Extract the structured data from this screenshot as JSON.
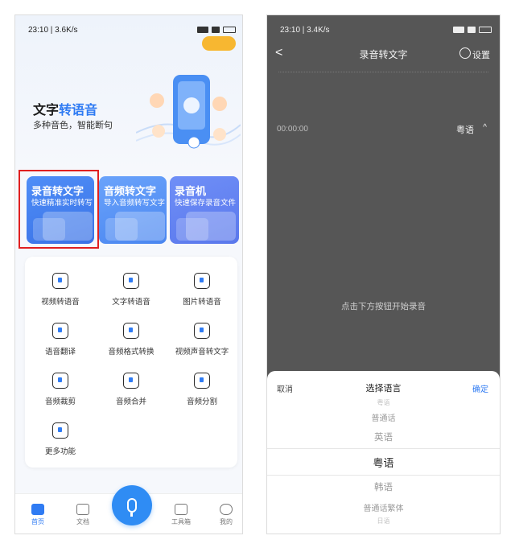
{
  "left": {
    "status": {
      "time": "23:10 | 3.6K/s"
    },
    "hero": {
      "title_prefix": "文字",
      "title_highlight": "转语音",
      "subtitle": "多种音色，智能断句"
    },
    "cards": [
      {
        "title": "录音转文字",
        "subtitle": "快速精准实时转写"
      },
      {
        "title": "音频转文字",
        "subtitle": "导入音频转写文字"
      },
      {
        "title": "录音机",
        "subtitle": "快速保存录音文件"
      }
    ],
    "grid": [
      {
        "label": "视频转语音",
        "icon": "video-play-icon"
      },
      {
        "label": "文字转语音",
        "icon": "text-t-icon"
      },
      {
        "label": "图片转语音",
        "icon": "image-icon"
      },
      {
        "label": "语音翻译",
        "icon": "translate-icon"
      },
      {
        "label": "音频格式转换",
        "icon": "convert-icon"
      },
      {
        "label": "视频声音转文字",
        "icon": "video-text-icon"
      },
      {
        "label": "音频裁剪",
        "icon": "crop-icon"
      },
      {
        "label": "音频合并",
        "icon": "merge-icon"
      },
      {
        "label": "音频分割",
        "icon": "split-icon"
      },
      {
        "label": "更多功能",
        "icon": "more-grid-icon"
      }
    ],
    "nav": [
      {
        "label": "首页",
        "icon": "home-icon",
        "active": true
      },
      {
        "label": "文档",
        "icon": "folder-icon",
        "active": false
      },
      {
        "label": "工具箱",
        "icon": "toolbox-icon",
        "active": false
      },
      {
        "label": "我的",
        "icon": "profile-icon",
        "active": false
      }
    ],
    "accent": "#2f7bf3"
  },
  "right": {
    "status": {
      "time": "23:10 | 3.4K/s"
    },
    "header": {
      "back": "<",
      "title": "录音转文字",
      "settings": "设置"
    },
    "timer": "00:00:00",
    "current_language": "粤语",
    "hint": "点击下方按钮开始录音",
    "sheet": {
      "cancel": "取消",
      "title": "选择语言",
      "confirm": "确定",
      "options": [
        "粤语",
        "普通话",
        "英语",
        "粤语",
        "韩语",
        "普通话繁体",
        "日语"
      ],
      "selected": "粤语"
    }
  }
}
